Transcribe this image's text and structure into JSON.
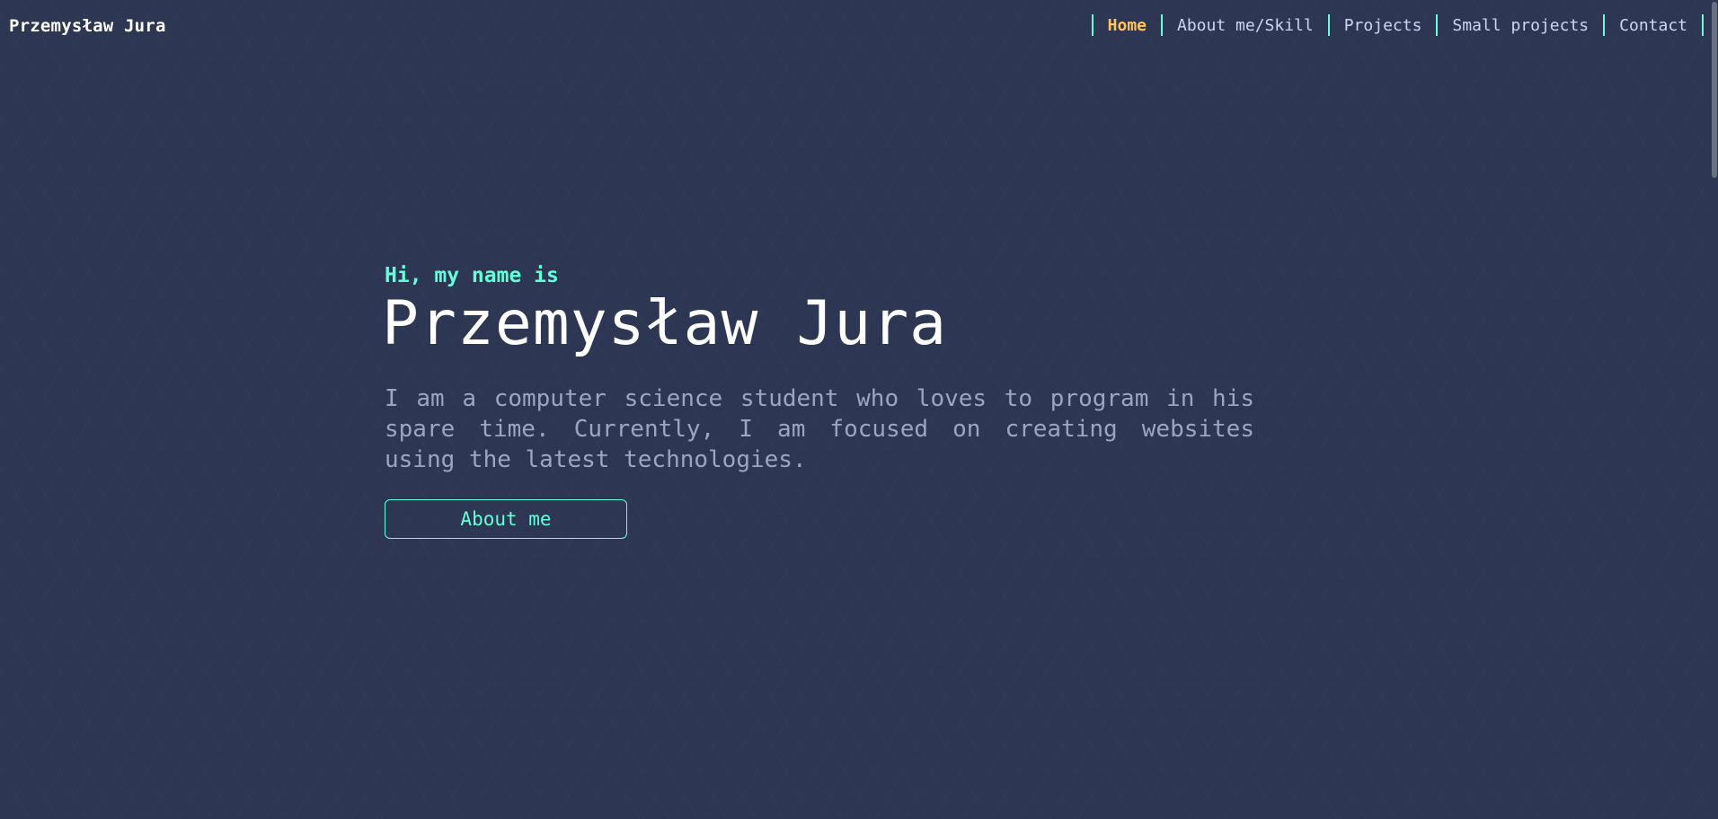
{
  "header": {
    "brand": "Przemysław Jura",
    "nav": [
      {
        "label": "Home",
        "active": true
      },
      {
        "label": "About me/Skill",
        "active": false
      },
      {
        "label": "Projects",
        "active": false
      },
      {
        "label": "Small projects",
        "active": false
      },
      {
        "label": "Contact",
        "active": false
      }
    ]
  },
  "hero": {
    "greeting": "Hi, my name is",
    "name": "Przemysław Jura",
    "description": "I am a computer science student who loves to program in his spare time. Currently, I am focused on creating websites using the latest technologies.",
    "button_label": "About me"
  },
  "colors": {
    "background": "#2d3652",
    "accent": "#64ffda",
    "active_nav": "#ffc55c",
    "text_primary": "#ffffff",
    "text_secondary": "#a8b2d1"
  }
}
